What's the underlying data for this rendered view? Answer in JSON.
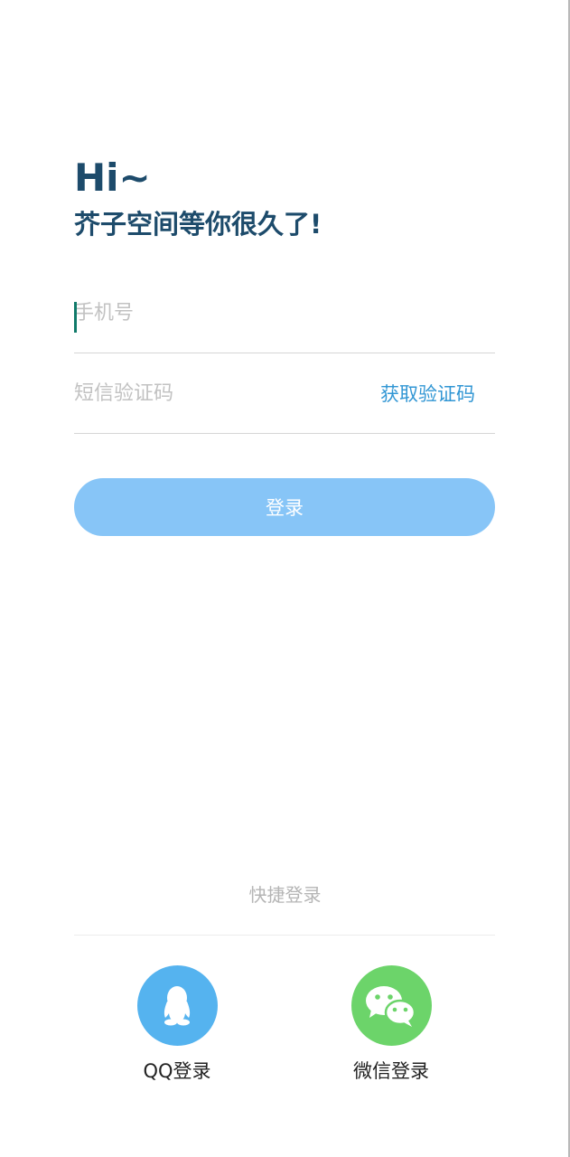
{
  "header": {
    "greeting": "Hi~",
    "welcome": "芥子空间等你很久了!"
  },
  "form": {
    "phone_placeholder": "手机号",
    "code_placeholder": "短信验证码",
    "get_code_label": "获取验证码",
    "login_label": "登录"
  },
  "quick_login": {
    "label": "快捷登录",
    "qq": {
      "label": "QQ登录",
      "icon": "qq-penguin-icon",
      "color": "#55b3ef"
    },
    "wechat": {
      "label": "微信登录",
      "icon": "wechat-icon",
      "color": "#6cd46a"
    }
  },
  "colors": {
    "title": "#1d4b6b",
    "accent": "#3196d4",
    "login_button": "#87c5f7"
  }
}
